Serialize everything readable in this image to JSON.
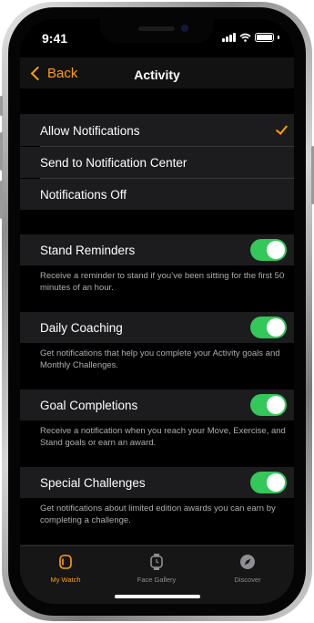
{
  "status_bar": {
    "time": "9:41"
  },
  "nav": {
    "back_label": "Back",
    "title": "Activity"
  },
  "notification_options": [
    {
      "label": "Allow Notifications",
      "selected": true
    },
    {
      "label": "Send to Notification Center",
      "selected": false
    },
    {
      "label": "Notifications Off",
      "selected": false
    }
  ],
  "settings": [
    {
      "label": "Stand Reminders",
      "enabled": true,
      "description": "Receive a reminder to stand if you’ve been sitting for the first 50 minutes of an hour."
    },
    {
      "label": "Daily Coaching",
      "enabled": true,
      "description": "Get notifications that help you complete your Activity goals and Monthly Challenges."
    },
    {
      "label": "Goal Completions",
      "enabled": true,
      "description": "Receive a notification when you reach your Move, Exercise, and Stand goals or earn an award."
    },
    {
      "label": "Special Challenges",
      "enabled": true,
      "description": "Get notifications about limited edition awards you can earn by completing a challenge."
    }
  ],
  "tab_bar": {
    "tabs": [
      {
        "label": "My Watch",
        "icon": "watch-icon",
        "active": true
      },
      {
        "label": "Face Gallery",
        "icon": "watch-face-icon",
        "active": false
      },
      {
        "label": "Discover",
        "icon": "compass-icon",
        "active": false
      }
    ]
  },
  "colors": {
    "accent": "#ff9f0a",
    "toggle_on": "#34c759",
    "background": "#000000",
    "cell": "#1c1c1e"
  }
}
